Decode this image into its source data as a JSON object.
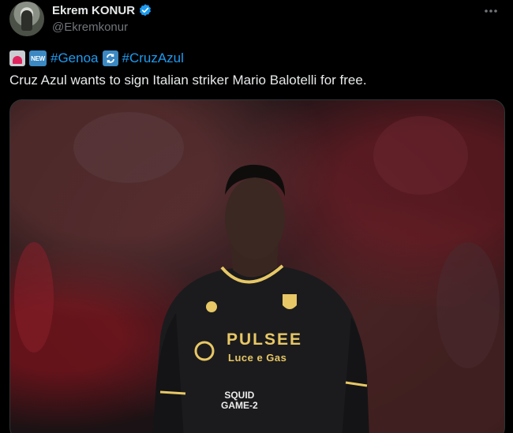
{
  "author": {
    "display_name": "Ekrem KONUR",
    "handle": "@Ekremkonur",
    "verified": true,
    "avatar_icon": "user-avatar-photo"
  },
  "header": {
    "more_icon": "more-horizontal-icon"
  },
  "tweet": {
    "tags": {
      "emoji_1": "police-car-light-emoji",
      "emoji_2_label": "NEW",
      "hashtag_1": "#Genoa",
      "emoji_3_icon": "repeat-arrows-emoji",
      "hashtag_2": "#CruzAzul"
    },
    "text": "Cruz Azul wants to sign Italian striker Mario Balotelli for free."
  },
  "media": {
    "type": "photo",
    "jersey_sponsor": "PULSEE",
    "jersey_sponsor_sub": "Luce e Gas",
    "jersey_sleeve_sponsor_line1": "SQUID",
    "jersey_sleeve_sponsor_line2": "GAME-2"
  },
  "colors": {
    "background": "#000000",
    "text_primary": "#e7e9ea",
    "text_secondary": "#71767b",
    "accent": "#1d9bf0",
    "jersey_gold": "#e7c766"
  }
}
